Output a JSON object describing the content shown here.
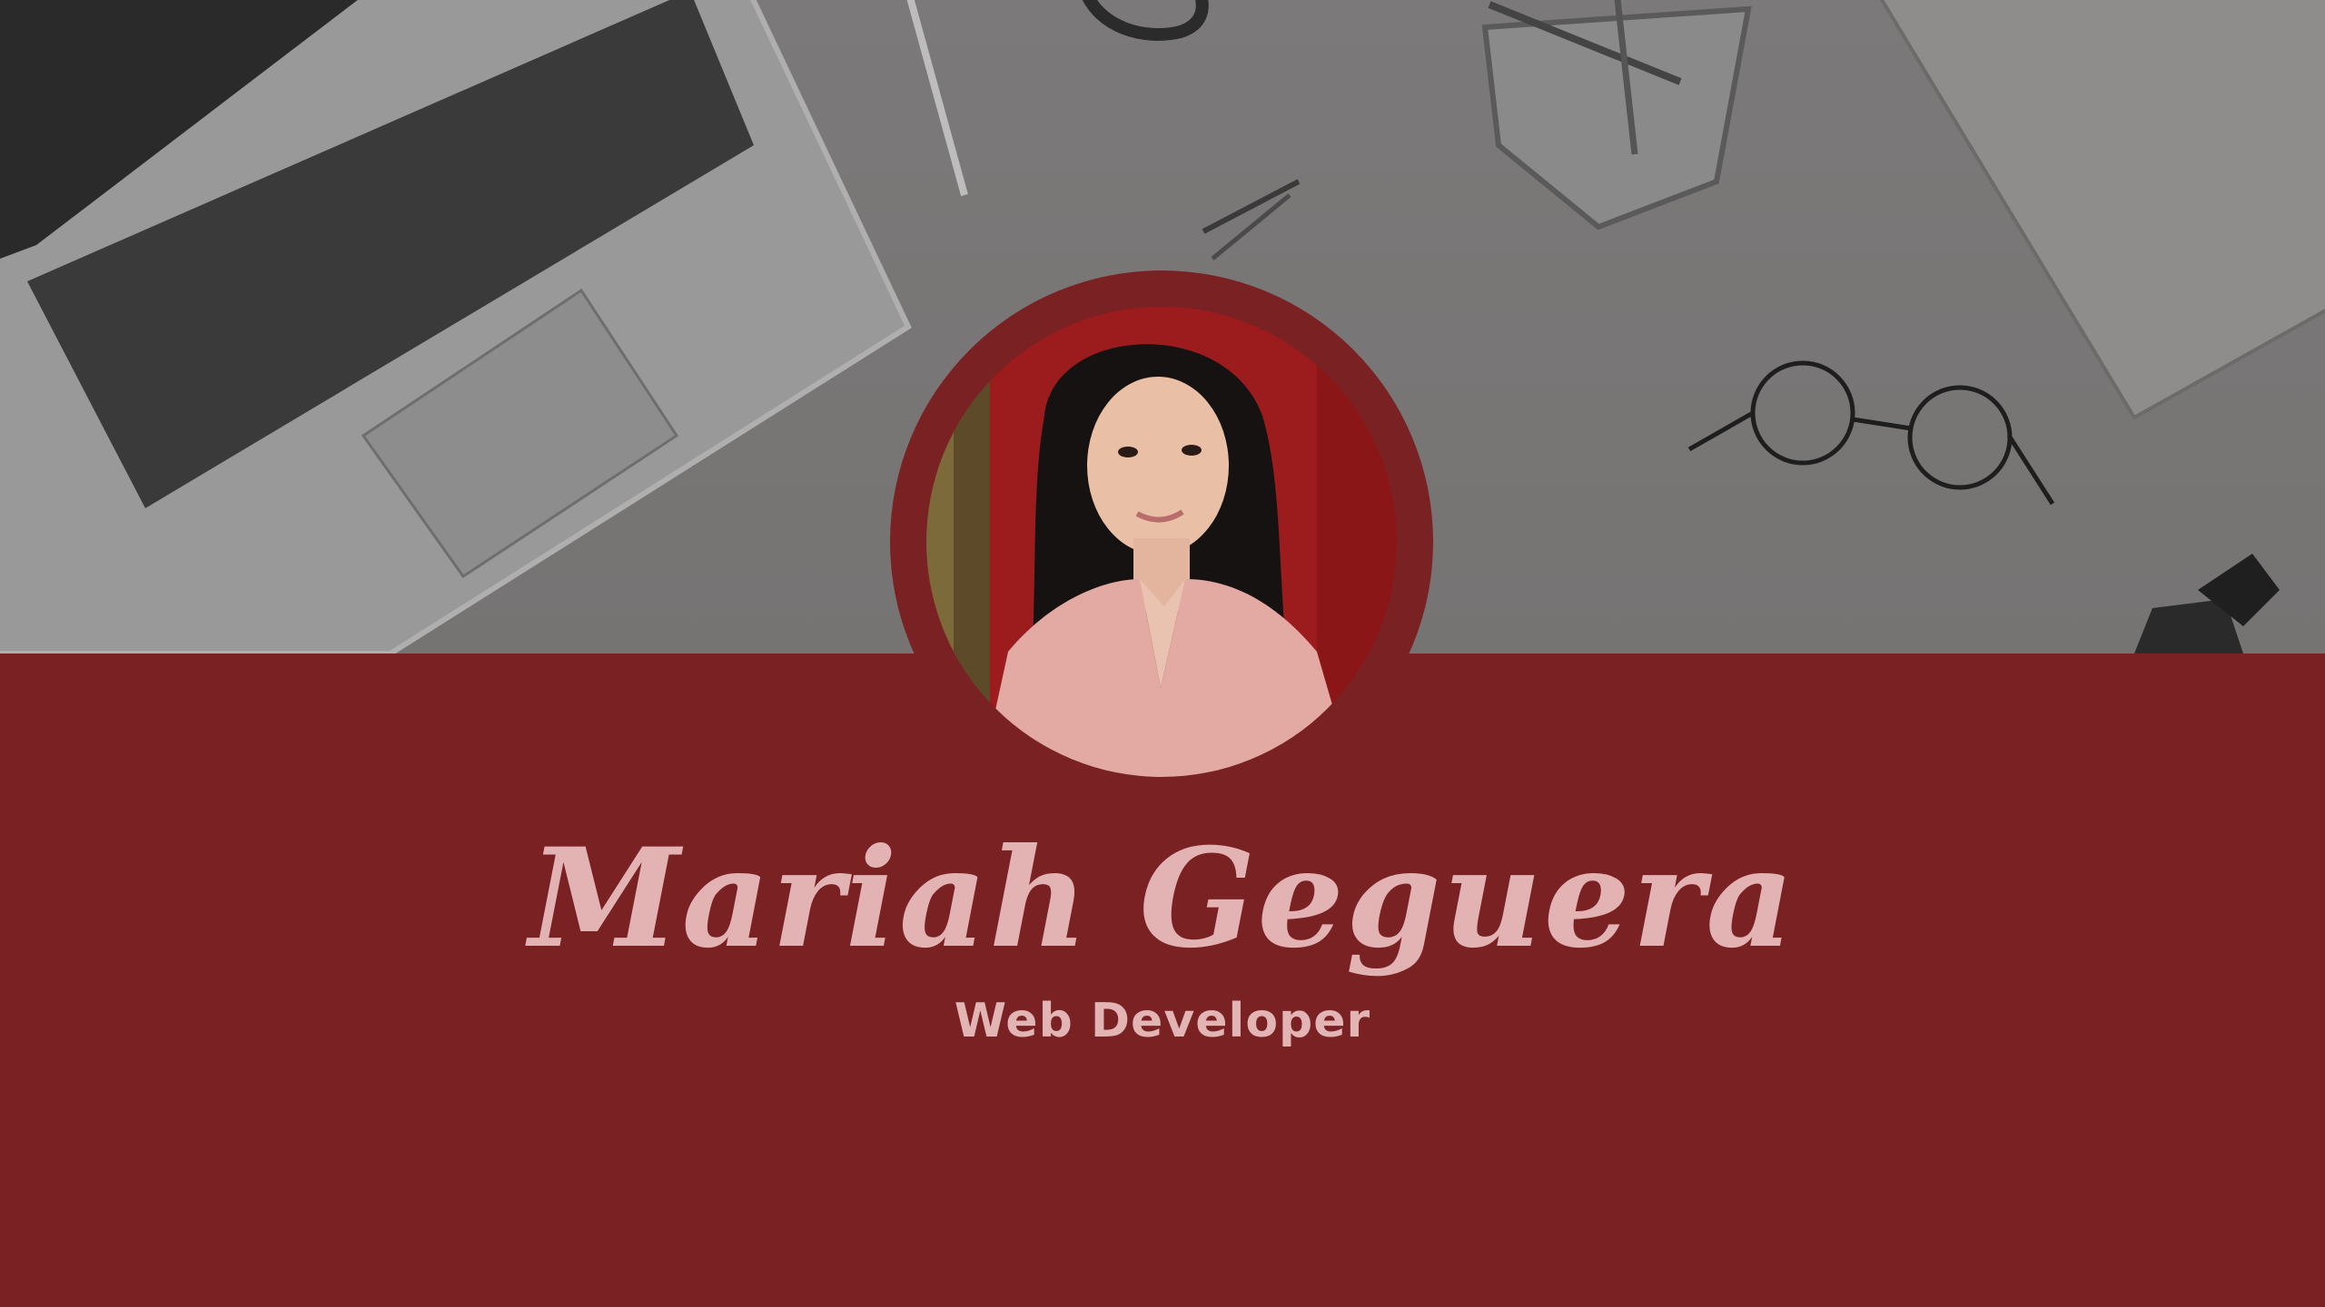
{
  "profile": {
    "name": "Mariah Geguera",
    "role": "Web Developer"
  },
  "colors": {
    "band": "#7a2124",
    "desk": "#787676",
    "text": "#e3b3b3"
  },
  "icons": {
    "avatar": "profile-photo"
  }
}
